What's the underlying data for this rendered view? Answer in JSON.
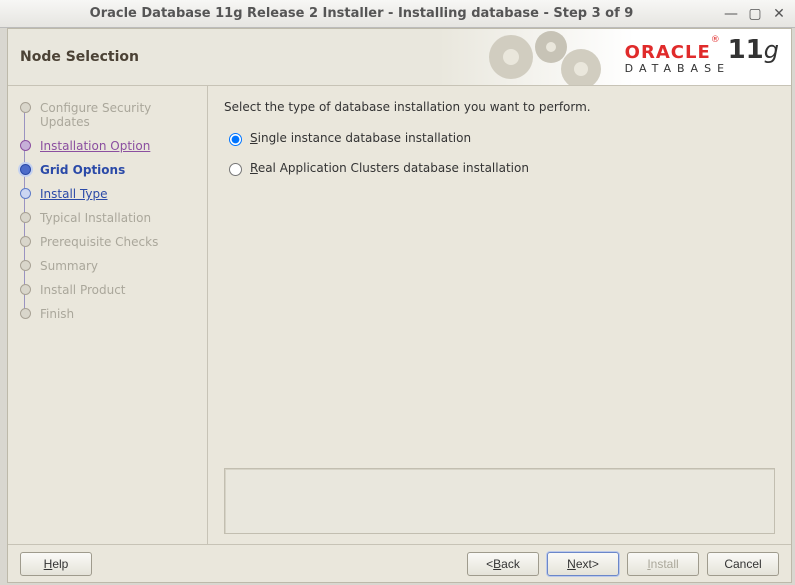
{
  "window": {
    "title": "Oracle Database 11g Release 2 Installer - Installing database - Step 3 of 9"
  },
  "header": {
    "page_title": "Node Selection",
    "brand_word": "ORACLE",
    "brand_sub": "DATABASE",
    "brand_ver_num": "11",
    "brand_ver_g": "g"
  },
  "steps": [
    {
      "label": "Configure Security Updates",
      "state": ""
    },
    {
      "label": "Installation Option",
      "state": "done"
    },
    {
      "label": "Grid Options",
      "state": "current"
    },
    {
      "label": "Install Type",
      "state": "next"
    },
    {
      "label": "Typical Installation",
      "state": ""
    },
    {
      "label": "Prerequisite Checks",
      "state": ""
    },
    {
      "label": "Summary",
      "state": ""
    },
    {
      "label": "Install Product",
      "state": ""
    },
    {
      "label": "Finish",
      "state": ""
    }
  ],
  "content": {
    "instruction": "Select the type of database installation you want to perform.",
    "radios": [
      {
        "mnemonic": "S",
        "rest": "ingle instance database installation",
        "checked": true
      },
      {
        "mnemonic": "R",
        "rest": "eal Application Clusters database installation",
        "checked": false
      }
    ]
  },
  "footer": {
    "help": "Help",
    "back": "Back",
    "next": "Next",
    "install": "Install",
    "cancel": "Cancel"
  }
}
